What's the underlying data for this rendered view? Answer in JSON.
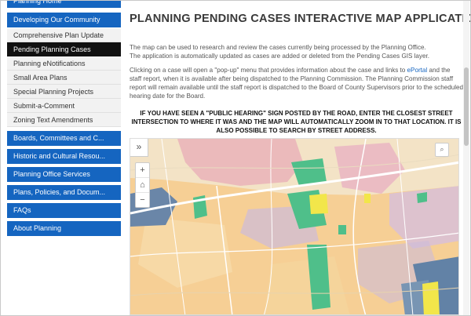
{
  "sidebar": {
    "top_partial": "Planning Home",
    "section": "Developing Our Community",
    "items": [
      "Comprehensive Plan Update",
      "Pending Planning Cases",
      "Planning eNotifications",
      "Small Area Plans",
      "Special Planning Projects",
      "Submit-a-Comment",
      "Zoning Text Amendments"
    ],
    "active_item": "Pending Planning Cases",
    "groups": [
      "Boards, Committees and C...",
      "Historic and Cultural Resou...",
      "Planning Office Services",
      "Plans, Policies, and Docum...",
      "FAQs",
      "About Planning"
    ]
  },
  "main": {
    "title": "PLANNING PENDING CASES INTERACTIVE MAP APPLICATION",
    "para1_line1": "The map can be used to research and review the cases currently being processed by the Planning Office.",
    "para1_line2": "The application is automatically updated as cases are added or deleted from the Pending Cases GIS layer.",
    "para2_before_link": "Clicking on a case will open a \"pop-up\" menu that provides information about the case and links to ",
    "para2_link": "ePortal",
    "para2_after_link": " and the staff report, when it is available after being dispatched to the Planning Commission. The Planning Commission staff report will remain available until the staff report is dispatched to the Board of County Supervisors prior to the scheduled hearing date for the Board.",
    "notice": "IF YOU HAVE SEEN A \"PUBLIC HEARING\" SIGN POSTED BY THE ROAD, ENTER THE CLOSEST STREET INTERSECTION TO WHERE IT WAS AND THE MAP WILL AUTOMATICALLY ZOOM IN TO THAT LOCATION. IT IS ALSO POSSIBLE TO SEARCH BY STREET ADDRESS."
  },
  "map": {
    "expand_icon": "»",
    "search_icon": "⌕",
    "zoom_in": "+",
    "home_icon": "⌂",
    "zoom_out": "−",
    "colors": {
      "base": "#f3e9cf",
      "residential": "#f6c98a",
      "commercial": "#e7a9b4",
      "office": "#c9b8d8",
      "industrial": "#5f7fa6",
      "case_green": "#4fbf8a",
      "case_yellow": "#f2e64a",
      "road": "#ffffff"
    }
  }
}
